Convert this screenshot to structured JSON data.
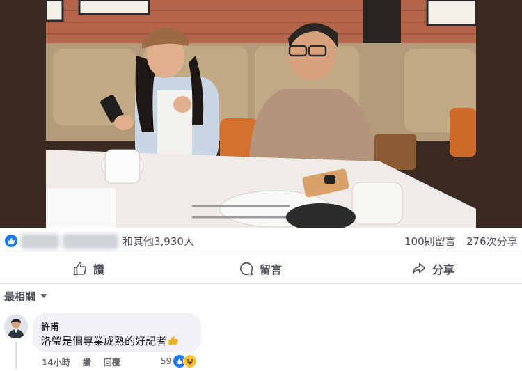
{
  "post": {
    "reactors_text": "和其他3,930人",
    "comment_count": "100則留言",
    "share_count": "276次分享"
  },
  "actions": {
    "like_label": "讚",
    "comment_label": "留言",
    "share_label": "分享"
  },
  "sort": {
    "label": "最相關"
  },
  "comment": {
    "author": "許甫",
    "text": "洛瑩是個專業成熟的好記者",
    "time": "14小時",
    "like_label": "讚",
    "reply_label": "回覆",
    "reaction_count": "59"
  },
  "colors": {
    "accent": "#1877f2",
    "secondary_text": "#65676b",
    "bubble": "#f0f2f5"
  }
}
